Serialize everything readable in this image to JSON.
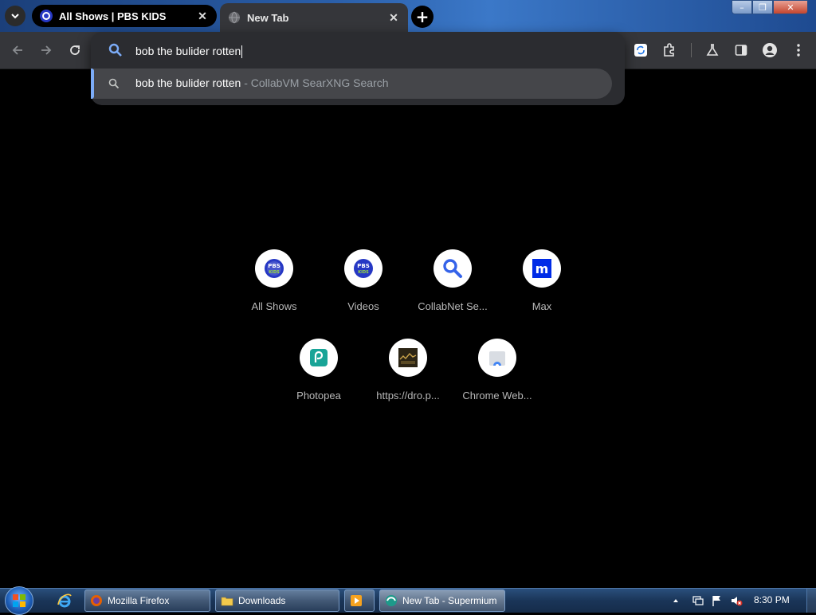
{
  "browser": {
    "tabs": [
      {
        "title": "All Shows | PBS KIDS",
        "favicon": "pbs-kids-icon"
      },
      {
        "title": "New Tab",
        "favicon": "globe-icon"
      }
    ],
    "tab_close_glyph": "✕",
    "new_tab_glyph": "+",
    "window_controls": {
      "minimize": "–",
      "maximize": "❐",
      "close": "✕"
    }
  },
  "omnibox": {
    "value": "bob the bulider rotten",
    "suggestion": {
      "text": "bob the bulider rotten",
      "source": " - CollabVM SearXNG Search"
    }
  },
  "shortcuts": [
    {
      "label": "All Shows",
      "icon": "pbs-kids-icon"
    },
    {
      "label": "Videos",
      "icon": "pbs-kids-icon"
    },
    {
      "label": "CollabNet Se...",
      "icon": "search-icon"
    },
    {
      "label": "Max",
      "icon": "max-icon"
    },
    {
      "label": "Photopea",
      "icon": "photopea-icon"
    },
    {
      "label": "https://dro.p...",
      "icon": "thumbnail-icon"
    },
    {
      "label": "Chrome Web...",
      "icon": "chrome-web-store-icon"
    }
  ],
  "taskbar": {
    "apps": [
      {
        "label": "Mozilla Firefox",
        "icon": "firefox-icon"
      },
      {
        "label": "Downloads",
        "icon": "folder-icon"
      },
      {
        "label": "",
        "icon": "media-player-icon"
      },
      {
        "label": "New Tab - Supermium",
        "icon": "supermium-icon"
      }
    ],
    "clock": "8:30 PM"
  },
  "colors": {
    "toolbar": "#35363a",
    "omnibox": "#2b2c30",
    "suggestion_highlight": "#45464a",
    "accent": "#7cacf8",
    "page_bg": "#000000",
    "pbs_blue": "#2638c4"
  }
}
